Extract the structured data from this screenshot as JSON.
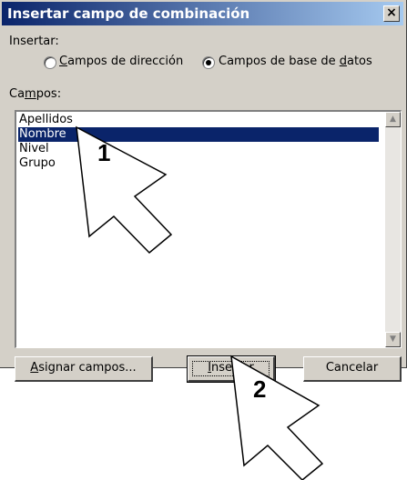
{
  "dialog": {
    "title": "Insertar campo de combinación",
    "close_glyph": "×",
    "insert_label": "Insertar:",
    "radio_address": {
      "label_first": "C",
      "label_rest": "ampos de dirección",
      "checked": false
    },
    "radio_database": {
      "label_pre": "Campos de base de ",
      "label_u": "d",
      "label_post": "atos",
      "checked": true
    },
    "fields_label": {
      "pre": "Ca",
      "u": "m",
      "post": "pos:"
    },
    "fields": [
      "Apellidos",
      "Nombre",
      "Nivel",
      "Grupo"
    ],
    "selected_field": "Nombre",
    "buttons": {
      "assign": {
        "u": "A",
        "rest": "signar campos..."
      },
      "insert": {
        "u": "I",
        "rest": "nsertar"
      },
      "cancel": "Cancelar"
    }
  },
  "annotations": {
    "step1": "1",
    "step2": "2"
  },
  "icons": {
    "scroll_up": "scroll-up-arrow-icon",
    "scroll_down": "scroll-down-arrow-icon"
  }
}
